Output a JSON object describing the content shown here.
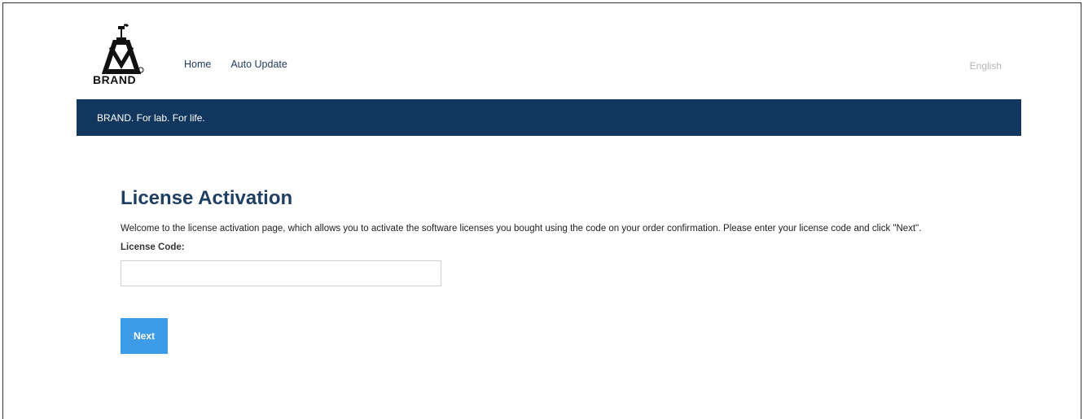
{
  "header": {
    "logo_text": "BRAND",
    "nav": [
      {
        "label": "Home"
      },
      {
        "label": "Auto Update"
      }
    ],
    "language": "English"
  },
  "banner": {
    "tagline": "BRAND. For lab. For life."
  },
  "main": {
    "title": "License Activation",
    "description": "Welcome to the license activation page, which allows you to activate the software licenses you bought using the code on your order confirmation. Please enter your license code and click \"Next\".",
    "license_label": "License Code:",
    "license_value": "",
    "next_label": "Next"
  },
  "colors": {
    "banner": "#11375e",
    "title": "#1f3f63",
    "button": "#3e9ce6",
    "nav_link": "#1e3a5c"
  },
  "icons": {
    "logo": "brand-flask-logo"
  }
}
